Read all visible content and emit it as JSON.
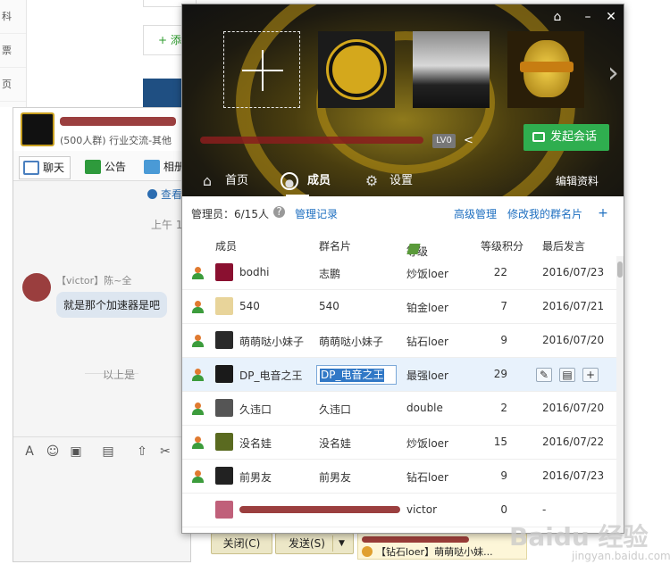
{
  "background": {
    "left_items": [
      "科",
      "票",
      "页"
    ],
    "add_label": "+ 添"
  },
  "chat": {
    "group_info": "(500人群) 行业交流-其他",
    "tabs": [
      "聊天",
      "公告",
      "相册"
    ],
    "see_link": "查看",
    "time": "上午 1",
    "sender": "【victor】陈~全",
    "message": "就是那个加速器是吧",
    "above_text": "以上是",
    "close_button": "关闭(C)",
    "send_button": "发送(S)",
    "notification": "【钻石loer】萌萌哒小妹..."
  },
  "watermark": {
    "text": "Baidu 经验",
    "sub": "jingyan.baidu.com"
  },
  "panel": {
    "level_badge": "LV0",
    "start_chat": "发起会话",
    "tabs": [
      {
        "label": "首页",
        "icon": "home-icon"
      },
      {
        "label": "成员",
        "icon": "user-icon"
      },
      {
        "label": "设置",
        "icon": "gear-icon"
      }
    ],
    "edit_info": "编辑资料",
    "admin_count": "管理员：6/15人",
    "manage_record": "管理记录",
    "advanced_manage": "高级管理",
    "edit_my_card": "修改我的群名片",
    "columns": [
      "成员",
      "群名片",
      "等级",
      "等级积分",
      "最后发言"
    ],
    "members": [
      {
        "name": "bodhi",
        "card": "志鹏",
        "level": "炒饭loer",
        "points": "22",
        "last": "2016/07/23",
        "avatar_color": "#8a1030",
        "selected": false,
        "admin": true
      },
      {
        "name": "540",
        "card": "540",
        "level": "铂金loer",
        "points": "7",
        "last": "2016/07/21",
        "avatar_color": "#e8d49a",
        "selected": false,
        "admin": true
      },
      {
        "name": "萌萌哒小妹子",
        "card": "萌萌哒小妹子",
        "level": "钻石loer",
        "points": "9",
        "last": "2016/07/20",
        "avatar_color": "#2a2a2a",
        "selected": false,
        "admin": true
      },
      {
        "name": "DP_电音之王",
        "card": "DP_电音之王",
        "level": "最强loer",
        "points": "29",
        "last": "",
        "avatar_color": "#1a1a1a",
        "selected": true,
        "admin": true
      },
      {
        "name": "久违口",
        "card": "久违口",
        "level": "double",
        "points": "2",
        "last": "2016/07/20",
        "avatar_color": "#555555",
        "selected": false,
        "admin": true
      },
      {
        "name": "没名娃",
        "card": "没名娃",
        "level": "炒饭loer",
        "points": "15",
        "last": "2016/07/22",
        "avatar_color": "#5a6a20",
        "selected": false,
        "admin": true
      },
      {
        "name": "前男友",
        "card": "前男友",
        "level": "钻石loer",
        "points": "9",
        "last": "2016/07/23",
        "avatar_color": "#222222",
        "selected": false,
        "admin": true
      },
      {
        "name": "",
        "card": "",
        "level": "victor",
        "points": "0",
        "last": "-",
        "avatar_color": "#c0607a",
        "selected": false,
        "admin": false
      }
    ]
  }
}
